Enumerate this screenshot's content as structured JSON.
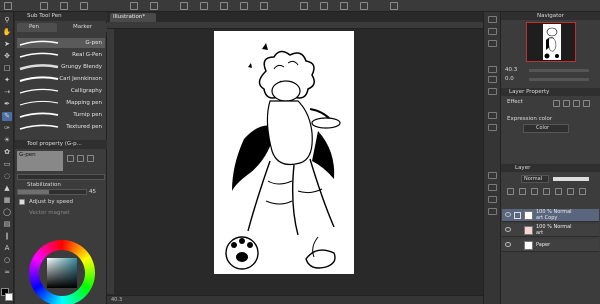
{
  "document_tab": "Illustration*",
  "subtool_panel": {
    "header_title": "Sub Tool Pen",
    "tabs": [
      {
        "label": "Pen"
      },
      {
        "label": "Marker"
      }
    ],
    "brushes": [
      {
        "label": "G-pen"
      },
      {
        "label": "Real G-Pen"
      },
      {
        "label": "Grungy Blendy"
      },
      {
        "label": "Carl Jennkinson"
      },
      {
        "label": "Calligraphy"
      },
      {
        "label": "Mapping pen"
      },
      {
        "label": "Turnip pen"
      },
      {
        "label": "Textured pen"
      }
    ]
  },
  "tool_property": {
    "header_title": "Tool property (G-p...",
    "brush_name": "G-pen",
    "stabilization_label": "Stabilization",
    "stabilization_value": "45",
    "adjust_by_speed_label": "Adjust by speed",
    "vector_magnet_label": "Vector magnet"
  },
  "navigator": {
    "header_title": "Navigator",
    "zoom_value": "40.3",
    "angle_value": "0.0"
  },
  "layer_property": {
    "header_title": "Layer Property",
    "effect_label": "Effect",
    "expression_color_label": "Expression color",
    "expression_color_value": "Color"
  },
  "layer_panel": {
    "header_title": "Layer",
    "blend_mode": "Normal",
    "opacity": "100",
    "layers": [
      {
        "line1": "100 % Normal",
        "line2": "art Copy",
        "selected": true
      },
      {
        "line1": "100 % Normal",
        "line2": "art",
        "selected": false
      },
      {
        "line1": "",
        "line2": "Paper",
        "selected": false
      }
    ]
  },
  "status_bar": {
    "zoom": "40.3"
  },
  "colors": {
    "selection": "#4a6fa5",
    "layer_selected": "#59667e",
    "navigator_frame": "#c03030"
  }
}
